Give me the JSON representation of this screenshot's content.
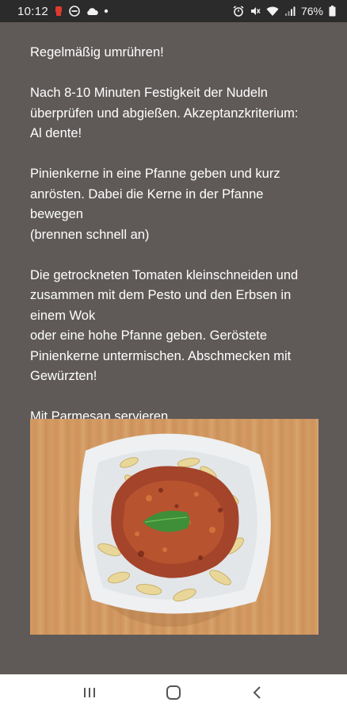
{
  "status_bar": {
    "time": "10:12",
    "battery": "76%",
    "icons_left": [
      "notification-icon",
      "dnd-icon",
      "cloud-icon",
      "dot-icon"
    ],
    "icons_right": [
      "alarm-icon",
      "mute-icon",
      "wifi-icon",
      "signal-icon",
      "battery-icon"
    ]
  },
  "recipe": {
    "paragraphs": [
      "Regelmäßig umrühren!",
      "Nach 8-10 Minuten Festigkeit der Nudeln\nüberprüfen und abgießen. Akzeptanzkriterium:\nAl dente!",
      "Pinienkerne in eine Pfanne geben und kurz\nanrösten. Dabei die Kerne in der Pfanne\nbewegen\n(brennen schnell an)",
      "Die getrockneten Tomaten kleinschneiden und\nzusammen mit dem Pesto und den Erbsen in\neinem Wok\noder eine hohe Pfanne geben. Geröstete\nPinienkerne untermischen. Abschmecken mit\nGewürzten!",
      "Mit Parmesan servieren."
    ]
  },
  "nav_bar": {
    "buttons": [
      "recent-apps-icon",
      "home-icon",
      "back-icon"
    ]
  },
  "colors": {
    "background": "#5f5a58",
    "status_bar": "#2b2b2b",
    "nav_bar": "#ffffff",
    "text": "#ffffff"
  }
}
